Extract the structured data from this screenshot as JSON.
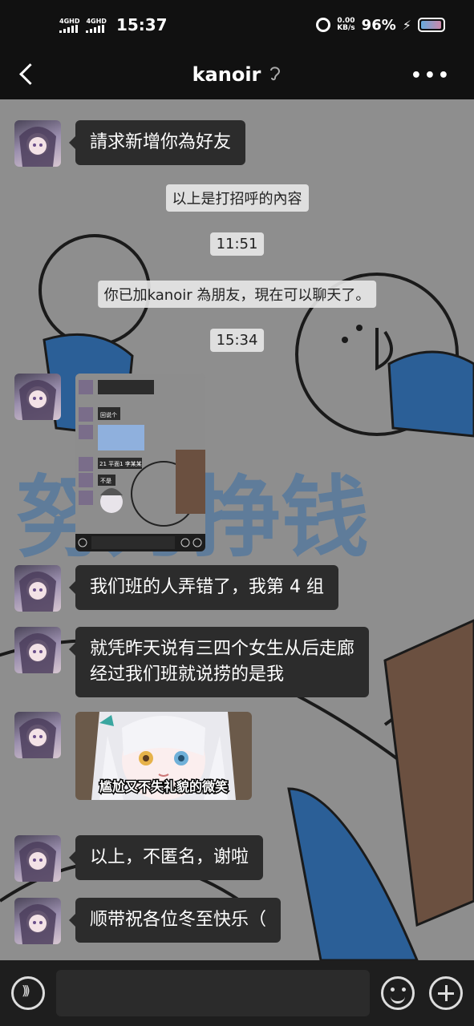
{
  "status_bar": {
    "sim1": "4GHD",
    "sim2": "4GHD",
    "time": "15:37",
    "net_speed_value": "0.00",
    "net_speed_unit": "KB/s",
    "battery_percent": "96%"
  },
  "header": {
    "title": "kanoir"
  },
  "messages": {
    "m1": "請求新增你為好友",
    "greeting_note": "以上是打招呼的內容",
    "time1": "11:51",
    "added_note": "你已加kanoir 為朋友，現在可以聊天了。",
    "time2": "15:34",
    "screenshot_texts": [
      "回说个",
      "21 平面1 李某某",
      "不是"
    ],
    "m2": "我们班的人弄错了，我第 4 组",
    "m3_line1": "就凭昨天说有三四个女生从后走廊",
    "m3_line2": "经过我们班就说捞的是我",
    "sticker_caption": "尴尬又不失礼貌的微笑",
    "m4": "以上，不匿名，谢啦",
    "m5": "顺带祝各位冬至快乐（"
  },
  "background": {
    "watermark": "努力挣钱"
  },
  "colors": {
    "chat_bg": "#8e8e8e",
    "bubble_bg": "#2c2c2c",
    "bar_bg": "#111111",
    "art_blue": "#2b5f97"
  },
  "icons": [
    "back-icon",
    "earpiece-icon",
    "more-icon",
    "voice-icon",
    "emoji-icon",
    "plus-icon",
    "alarm-icon",
    "battery-icon"
  ]
}
